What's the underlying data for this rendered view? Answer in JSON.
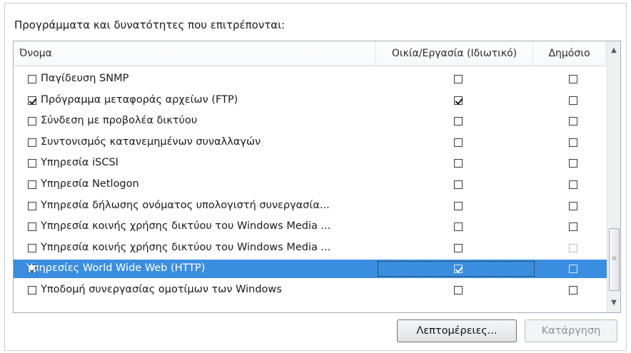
{
  "caption": "Προγράμματα και δυνατότητες που επιτρέπονται:",
  "columns": {
    "name": "Όνομα",
    "home_work": "Οικία/Εργασία (Ιδιωτικό)",
    "public": "Δημόσιο"
  },
  "rows": [
    {
      "name": "Παγίδευση SNMP",
      "enabled": false,
      "home_work": false,
      "public": false
    },
    {
      "name": "Πρόγραμμα μεταφοράς αρχείων (FTP)",
      "enabled": true,
      "home_work": true,
      "public": false
    },
    {
      "name": "Σύνδεση με προβολέα δικτύου",
      "enabled": false,
      "home_work": false,
      "public": false
    },
    {
      "name": "Συντονισμός κατανεμημένων συναλλαγών",
      "enabled": false,
      "home_work": false,
      "public": false
    },
    {
      "name": "Υπηρεσία iSCSI",
      "enabled": false,
      "home_work": false,
      "public": false
    },
    {
      "name": "Υπηρεσία Netlogon",
      "enabled": false,
      "home_work": false,
      "public": false
    },
    {
      "name": "Υπηρεσία δήλωσης ονόματος υπολογιστή συνεργασία...",
      "enabled": false,
      "home_work": false,
      "public": false
    },
    {
      "name": "Υπηρεσία κοινής χρήσης δικτύου του Windows Media ...",
      "enabled": false,
      "home_work": false,
      "public": false
    },
    {
      "name": "Υπηρεσία κοινής χρήσης δικτύου του Windows Media ...",
      "enabled": false,
      "home_work": false,
      "public": false,
      "public_dim": true
    },
    {
      "name": "Υπηρεσίες World Wide Web (HTTP)",
      "enabled": true,
      "home_work": true,
      "public": false,
      "selected": true
    },
    {
      "name": "Υποδομή συνεργασίας ομοτίμων των Windows",
      "enabled": false,
      "home_work": false,
      "public": false
    }
  ],
  "buttons": {
    "details": "Λεπτομέρειες...",
    "remove": "Κατάργηση"
  },
  "colors": {
    "selection": "#3b8edf",
    "disabled_text": "#8d9196"
  },
  "icons": {
    "scroll_up": "chevron-up-icon",
    "scroll_down": "chevron-down-icon"
  }
}
